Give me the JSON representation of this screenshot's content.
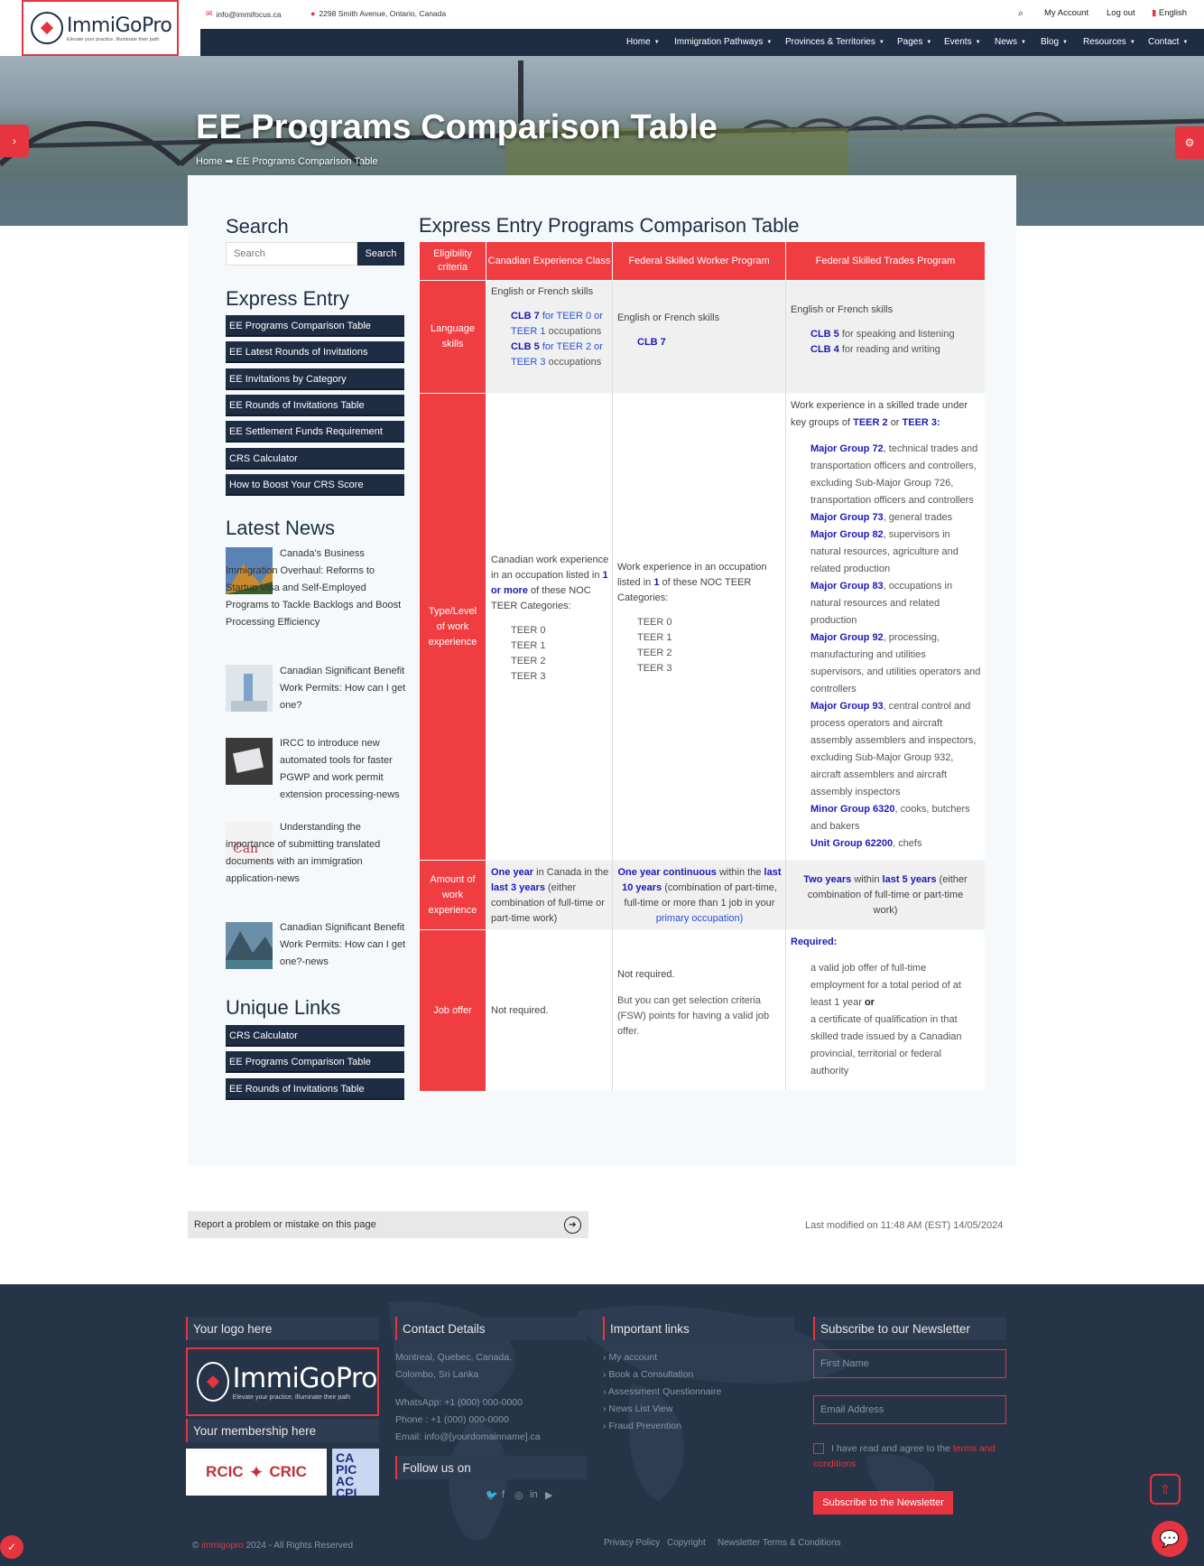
{
  "brand": {
    "name": "ImmiGoPro",
    "tagline": "Elevate your practice, Illuminate their path"
  },
  "topbar": {
    "email": "info@immifocus.ca",
    "address": "2298 Smith Avenue, Ontario, Canada",
    "my_account": "My Account",
    "logout": "Log out",
    "language": "English"
  },
  "nav": [
    "Home",
    "Immigration Pathways",
    "Provinces & Territories",
    "Pages",
    "Events",
    "News",
    "Blog",
    "Resources",
    "Contact"
  ],
  "hero": {
    "title": "EE Programs Comparison Table",
    "crumb_home": "Home",
    "crumb_arrow": "➡",
    "crumb_current": "EE Programs Comparison Table"
  },
  "sidebar": {
    "search_title": "Search",
    "search_placeholder": "Search",
    "search_button": "Search",
    "ee_title": "Express Entry",
    "ee_links": [
      "EE Programs Comparison Table",
      "EE Latest Rounds of Invitations",
      "EE Invitations by Category",
      "EE Rounds of Invitations Table",
      "EE Settlement Funds Requirement",
      "CRS Calculator",
      "How to Boost Your CRS Score"
    ],
    "news_title": "Latest News",
    "news": [
      "Canada's Business Immigration Overhaul: Reforms to Startup Visa and Self-Employed Programs to Tackle Backlogs and Boost Processing Efficiency",
      "Canadian Significant Benefit Work Permits: How can I get one?",
      "IRCC to introduce new automated tools for faster PGWP and work permit extension processing-news",
      "Understanding the importance of submitting translated documents with an immigration application-news",
      "Canadian Significant Benefit Work Permits: How can I get one?-news"
    ],
    "unique_title": "Unique Links",
    "unique_links": [
      "CRS Calculator",
      "EE Programs Comparison Table",
      "EE Rounds of Invitations Table"
    ]
  },
  "table": {
    "title": "Express Entry Programs Comparison Table",
    "headers": [
      "Eligibility criteria",
      "Canadian Experience Class",
      "Federal Skilled Worker Program",
      "Federal Skilled Trades Program"
    ],
    "labels": [
      "Language skills",
      "Type/Level of work experience",
      "Amount of work experience",
      "Job offer"
    ],
    "lang": {
      "cec_intro": "English or French skills",
      "cec_l1a": "CLB 7",
      "cec_l1b": "for",
      "cec_l1c": "TEER 0",
      "cec_l1d": "or",
      "cec_l1e": "TEER 1",
      "cec_l1f": "occupations",
      "cec_l2a": "CLB 5",
      "cec_l2b": "for",
      "cec_l2c": "TEER 2",
      "cec_l2d": "or",
      "cec_l2e": "TEER 3",
      "cec_l2f": "occupations",
      "fsw_intro": "English or French skills",
      "fsw_l1": "CLB 7",
      "fst_intro": "English or French skills",
      "fst_l1a": "CLB 5",
      "fst_l1b": "for speaking and listening",
      "fst_l2a": "CLB 4",
      "fst_l2b": "for reading and writing"
    },
    "work": {
      "cec_intro_a": "Canadian work experience in an occupation listed in",
      "cec_intro_b": "1 or more",
      "cec_intro_c": "of these NOC TEER Categories:",
      "cec_teers": [
        "TEER 0",
        "TEER 1",
        "TEER 2",
        "TEER 3"
      ],
      "fsw_intro_a": "Work experience in an occupation listed in",
      "fsw_intro_b": "1",
      "fsw_intro_c": "of these NOC TEER Categories:",
      "fsw_teers": [
        "TEER 0",
        "TEER 1",
        "TEER 2",
        "TEER 3"
      ],
      "fst_intro_a": "Work experience in a skilled trade under key groups of",
      "fst_intro_b": "TEER 2",
      "fst_intro_c": "or",
      "fst_intro_d": "TEER 3:",
      "groups": [
        {
          "name": "Major Group 72",
          "desc": ", technical trades and transportation officers and controllers, excluding Sub-Major Group 726, transportation officers and controllers"
        },
        {
          "name": "Major Group 73",
          "desc": ", general trades"
        },
        {
          "name": "Major Group 82",
          "desc": ", supervisors in natural resources, agriculture and related production"
        },
        {
          "name": "Major Group 83",
          "desc": ", occupations in natural resources and related production"
        },
        {
          "name": "Major Group 92",
          "desc": ", processing, manufacturing and utilities supervisors, and utilities operators and controllers"
        },
        {
          "name": "Major Group 93",
          "desc": ", central control and process operators and aircraft assembly assemblers and inspectors, excluding Sub-Major Group 932, aircraft assemblers and aircraft assembly inspectors"
        },
        {
          "name": "Minor Group 6320",
          "desc": ", cooks, butchers and bakers"
        },
        {
          "name": "Unit Group 62200",
          "desc": ", chefs"
        }
      ]
    },
    "amount": {
      "cec_a": "One year",
      "cec_b": "in Canada in the",
      "cec_c": "last 3 years",
      "cec_d": "(either combination of full-time or part-time work)",
      "fsw_a": "One year continuous",
      "fsw_b": "within the",
      "fsw_c": "last 10 years",
      "fsw_d": "(combination of part-time, full-time or more than 1 job in your",
      "fsw_e": "primary occupation)",
      "fst_a": "Two years",
      "fst_b": "within",
      "fst_c": "last 5 years",
      "fst_d": "(either combination of full-time or part-time work)"
    },
    "job": {
      "cec": "Not required.",
      "fsw_a": "Not required.",
      "fsw_b": "But you can get selection criteria (FSW) points for having a valid job offer.",
      "fst_req": "Required:",
      "fst_a": "a valid job offer of full-time employment for a total period of at least 1 year",
      "fst_or": "or",
      "fst_b": "a certificate of qualification in that skilled trade issued by a Canadian provincial, territorial or federal authority"
    }
  },
  "report": {
    "text": "Report a problem or mistake on this page",
    "last_modified": "Last modified on 11:48 AM (EST) 14/05/2024"
  },
  "footer": {
    "logo_title": "Your logo here",
    "membership_title": "Your membership here",
    "membership_rcic": "RCIC",
    "membership_cric": "CRIC",
    "membership_capic": "CA PIC AC CPI",
    "contact_title": "Contact Details",
    "contact_lines": [
      "Montreal, Quebec, Canada.",
      "Colombo, Sri Lanka",
      "",
      "WhatsApp: +1 (000) 000-0000",
      "Phone : +1 (000) 000-0000",
      "Email: info@[yourdomainname].ca"
    ],
    "follow_title": "Follow us on",
    "links_title": "Important links",
    "links": [
      "My account",
      "Book a Consultation",
      "Assessment Questionnaire",
      "News List View",
      "Fraud Prevention"
    ],
    "newsletter_title": "Subscribe to our Newsletter",
    "first_name_placeholder": "First Name",
    "email_placeholder": "Email Address",
    "agree_text": "I have read and agree to the",
    "agree_link": "terms and conditions",
    "subscribe_button": "Subscribe to the Newsletter",
    "copyright_brand": "immigopro",
    "copyright_rest": "2024 - All Rights Reserved",
    "bottom_links": [
      "Privacy Policy",
      "Copyright",
      "Newsletter Terms & Conditions"
    ]
  },
  "colors": {
    "accent": "#e63540",
    "navy": "#1e2d44",
    "footer": "#253447",
    "table_red": "#f03d42"
  }
}
